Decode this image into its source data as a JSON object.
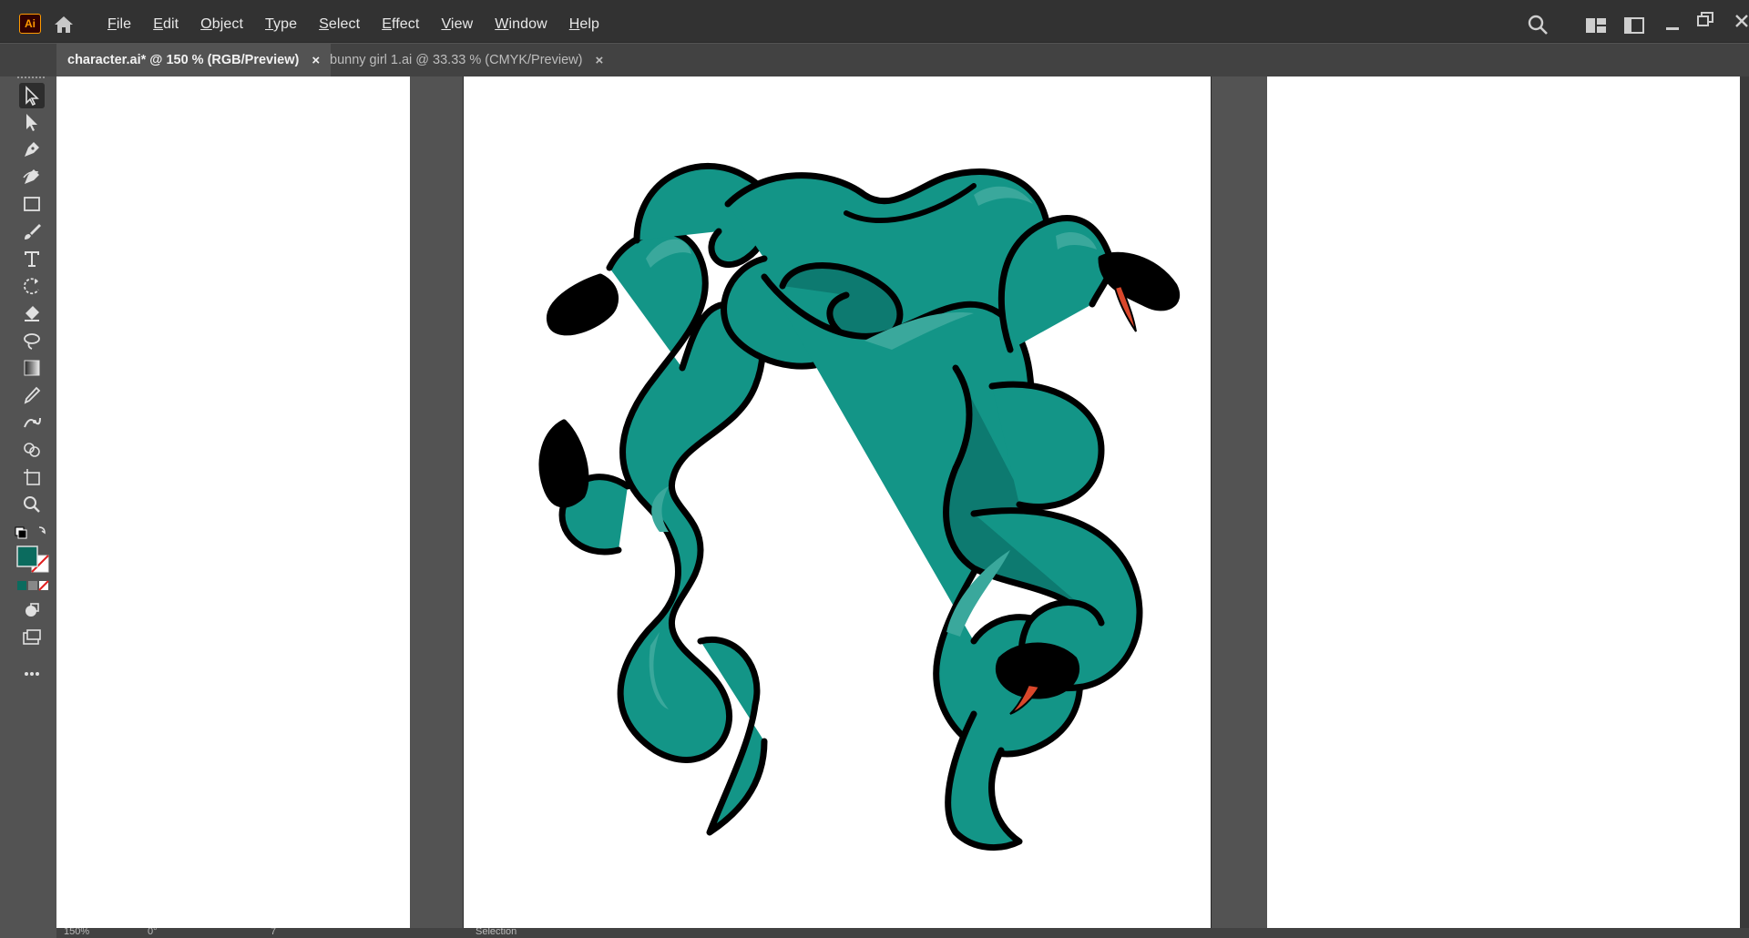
{
  "app": {
    "logo_text": "Ai"
  },
  "menu": [
    {
      "first": "F",
      "rest": "ile"
    },
    {
      "first": "E",
      "rest": "dit"
    },
    {
      "first": "O",
      "rest": "bject"
    },
    {
      "first": "T",
      "rest": "ype"
    },
    {
      "first": "S",
      "rest": "elect"
    },
    {
      "first": "E",
      "rest": "ffect"
    },
    {
      "first": "V",
      "rest": "iew"
    },
    {
      "first": "W",
      "rest": "indow"
    },
    {
      "first": "H",
      "rest": "elp"
    }
  ],
  "tabs": [
    {
      "label": "character.ai* @ 150 % (RGB/Preview)",
      "close": "×",
      "active": true
    },
    {
      "label": "bunny girl 1.ai @ 33.33 % (CMYK/Preview)",
      "close": "×",
      "active": false
    }
  ],
  "status": {
    "zoom": "150%",
    "angle": "0°",
    "page": "7",
    "tool": "Selection"
  },
  "colors": {
    "fill": "#0b6b5e",
    "snake_main": "#139587",
    "snake_light": "#3aa89c",
    "snake_dark": "#0d7a70",
    "outline": "#000000",
    "tongue": "#d9472b",
    "canvas_bg": "#535353",
    "menubar_bg": "#323232"
  },
  "icons": [
    "home-icon",
    "search-icon",
    "arrange-docs-icon",
    "workspace-icon",
    "minimize-icon",
    "restore-icon",
    "close-icon"
  ]
}
